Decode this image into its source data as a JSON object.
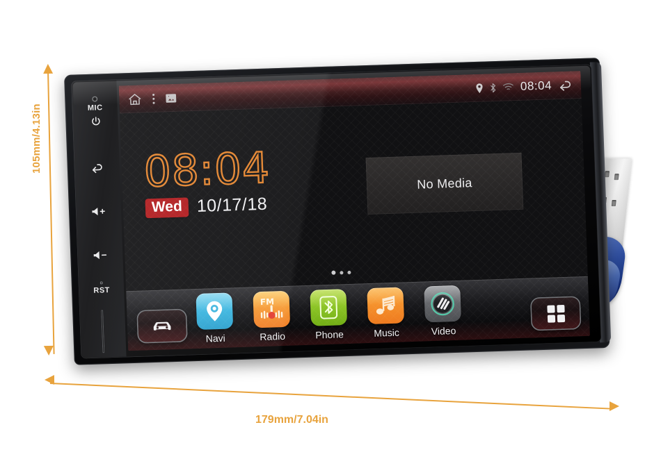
{
  "annotations": {
    "height_label": "105mm/4.13in",
    "width_label": "179mm/7.04in",
    "accent_color": "#e8a33d"
  },
  "hardware": {
    "mic_label": "MIC",
    "power_icon": "power-icon",
    "back_icon": "back-arrow-icon",
    "volume_up_label": "◁+",
    "volume_down_label": "◁-",
    "reset_label": "RST",
    "sd_slot": "sd-card-slot"
  },
  "navbar": {
    "home_icon": "home-icon",
    "menu_icon": "overflow-menu-icon",
    "wallpaper_icon": "wallpaper-icon",
    "status_icons": [
      "location-pin-icon",
      "bluetooth-icon",
      "wifi-icon"
    ],
    "time": "08:04",
    "back_icon": "back-arrow-icon"
  },
  "desktop": {
    "clock_time": "08:04",
    "day": "Wed",
    "date": "10/17/18",
    "day_badge_color": "#b0191c",
    "clock_color": "#e2822b",
    "media_panel_text": "No Media",
    "page_dots": 3,
    "active_dot_index": 0
  },
  "dock": {
    "car_button_icon": "car-icon",
    "apps_grid_button_icon": "apps-grid-icon",
    "apps": [
      {
        "label": "Navi",
        "icon": "map-pin-icon",
        "color": "#39b4de"
      },
      {
        "label": "Radio",
        "icon": "fm-radio-icon",
        "color": "#f79a34"
      },
      {
        "label": "Phone",
        "icon": "bluetooth-icon",
        "color": "#8cc426"
      },
      {
        "label": "Music",
        "icon": "music-note-icon",
        "color": "#f5912c"
      },
      {
        "label": "Video",
        "icon": "video-disc-icon",
        "color": "#66686c"
      }
    ]
  }
}
